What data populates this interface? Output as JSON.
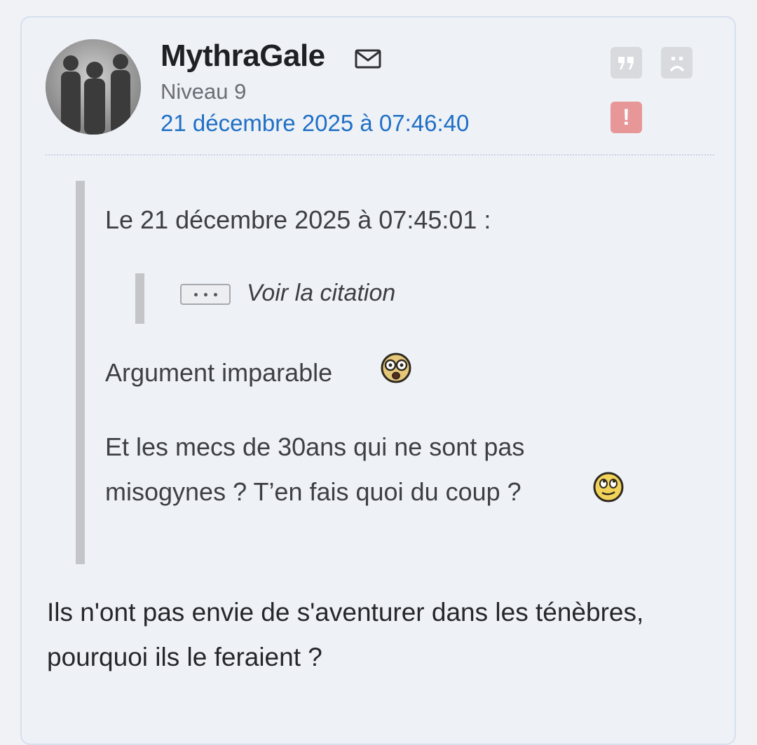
{
  "post": {
    "author": "MythraGale",
    "level": "Niveau 9",
    "date": "21 décembre 2025 à 07:46:40",
    "icons": {
      "message": "envelope-icon",
      "quote": "quote-icon",
      "sad": "sad-face-icon",
      "report": "alert-icon",
      "report_glyph": "!"
    },
    "colors": {
      "date_link": "#1f6fc5",
      "report_button": "#e79797",
      "card_background": "#eef1f6"
    }
  },
  "quote": {
    "header": "Le 21 décembre 2025 à 07:45:01 :",
    "show_quote_label": "Voir la citation",
    "lines": [
      "Argument imparable",
      "Et les mecs de 30ans qui ne sont pas",
      "misogynes ? T’en fais quoi du coup ?"
    ],
    "smileys": [
      "shocked-smiley-icon",
      "rolling-eyes-smiley-icon"
    ]
  },
  "message": {
    "lines": [
      "Ils n'ont pas envie de s'aventurer dans les ténèbres,",
      "pourquoi ils le feraient ?"
    ]
  }
}
